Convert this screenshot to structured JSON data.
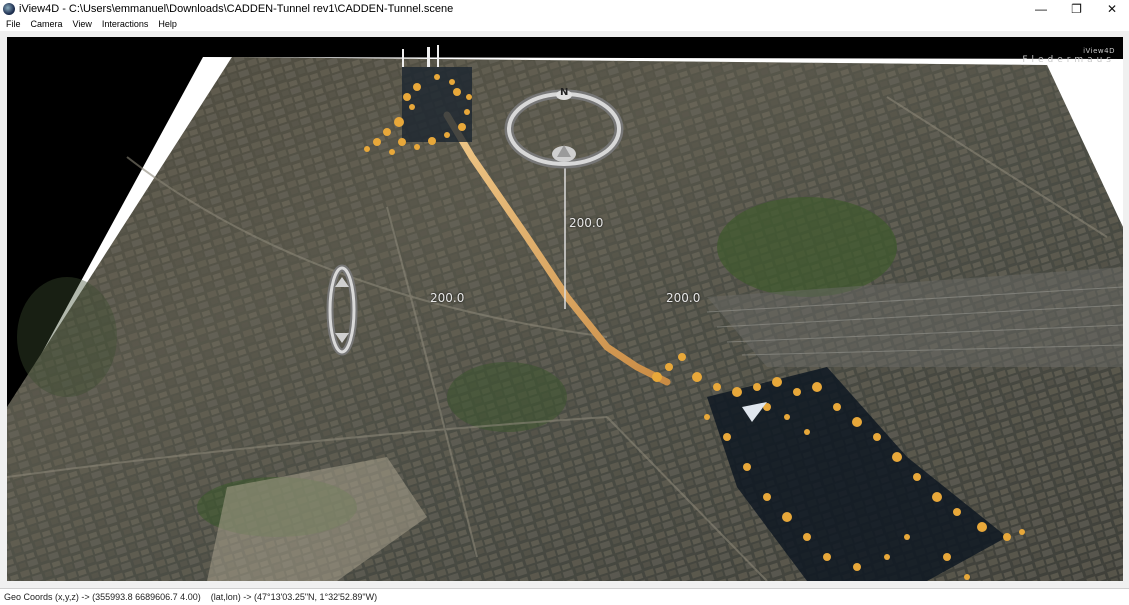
{
  "window": {
    "title": "iView4D - C:\\Users\\emmanuel\\Downloads\\CADDEN-Tunnel rev1\\CADDEN-Tunnel.scene",
    "app_icon": "iview4d-app-icon",
    "controls": {
      "minimize": "—",
      "maximize": "❐",
      "close": "✕"
    }
  },
  "menu": {
    "items": [
      {
        "label": "File"
      },
      {
        "label": "Camera"
      },
      {
        "label": "View"
      },
      {
        "label": "Interactions"
      },
      {
        "label": "Help"
      }
    ]
  },
  "viewport": {
    "brand_top": "iView4D",
    "brand_main": "Fledermaus",
    "compass_north": "N",
    "scale_labels": {
      "vertical": "200.0",
      "left": "200.0",
      "right": "200.0"
    },
    "colors": {
      "background": "#000000",
      "point_cloud": "#e8a83a",
      "tunnel": "#d49a50",
      "border_plane": "#ffffff"
    }
  },
  "status": {
    "geo_coords": "Geo Coords (x,y,z) -> (355993.8 6689606.7 4.00)",
    "latlon": "(lat,lon) -> (47°13'03.25\"N, 1°32'52.89\"W)"
  }
}
